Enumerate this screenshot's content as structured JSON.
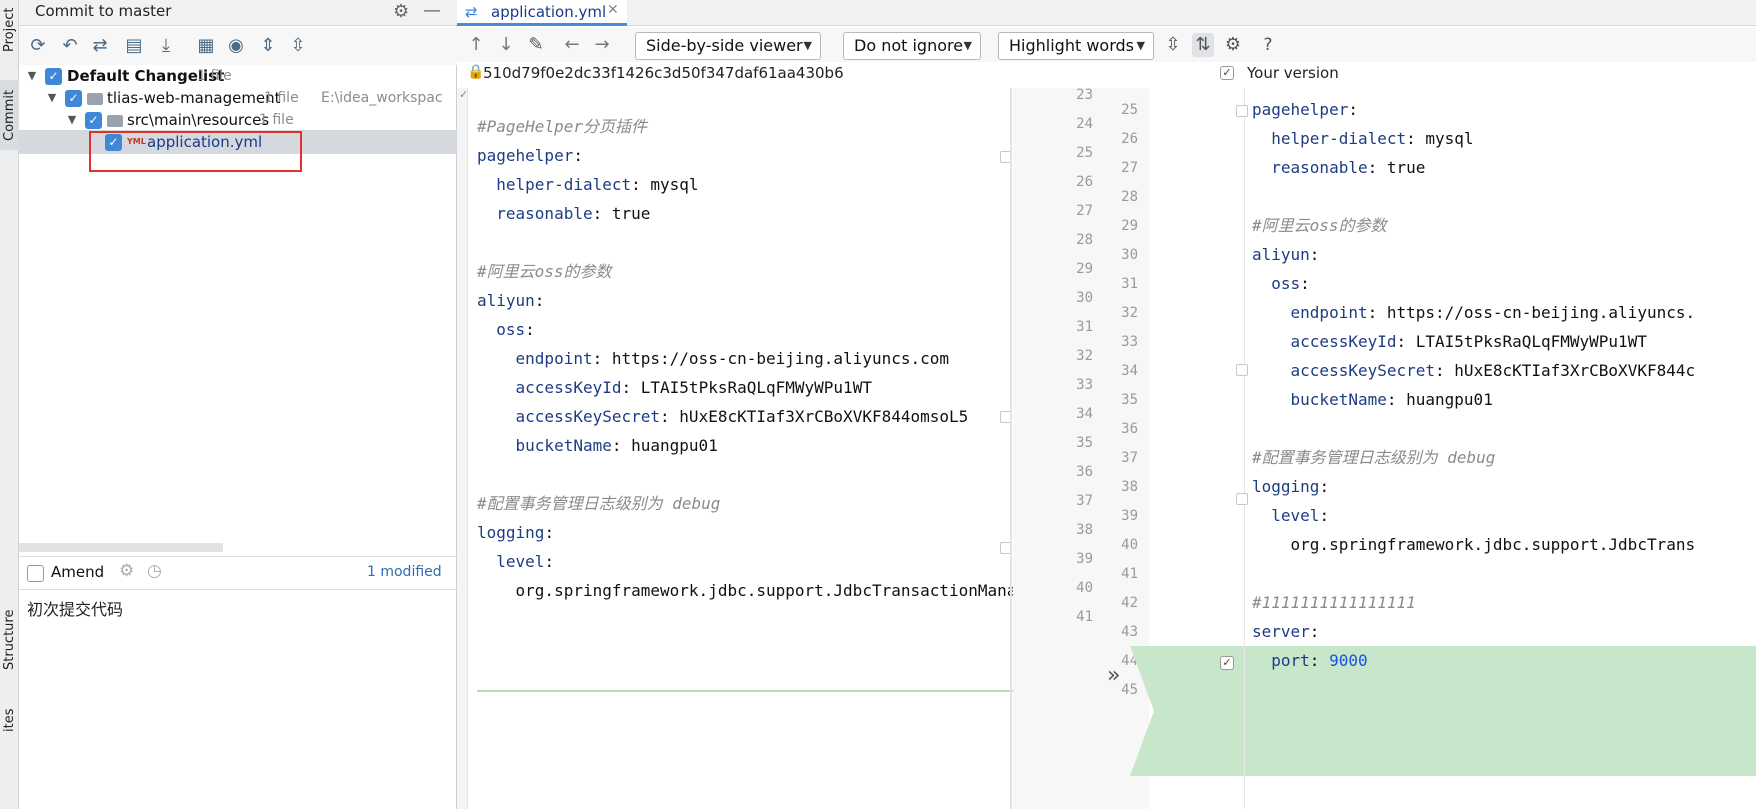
{
  "side_stripe": {
    "project": "Project",
    "commit": "Commit",
    "structure": "Structure",
    "favorites": "ites"
  },
  "left_panel": {
    "title": "Commit to master",
    "tree": {
      "changelist": {
        "label": "Default Changelist",
        "count": "1 file"
      },
      "module": {
        "label": "tlias-web-management",
        "count": "1 file",
        "path": "E:\\idea_workspac"
      },
      "folder": {
        "label": "src\\main\\resources",
        "count": "1 file"
      },
      "file": {
        "label": "application.yml",
        "icon_text": "YML"
      }
    },
    "amend_label": "Amend",
    "modified_label": "1 modified",
    "commit_message": "初次提交代码"
  },
  "diff": {
    "tab_label": "application.yml",
    "viewer_select": "Side-by-side viewer",
    "ignore_select": "Do not ignore",
    "highlight_select": "Highlight words",
    "help": "?",
    "revision_hash": "510d79f0e2dc33f1426c3d50f347daf61aa430b6",
    "your_version_label": "Your version",
    "colors": {
      "added_bg": "#c8e6c9",
      "key": "#1d3c82",
      "comment": "#8b8b8b",
      "number": "#1750eb"
    },
    "left_lines": [
      {
        "indent": "",
        "comment": "#PageHelper分页插件"
      },
      {
        "indent": "",
        "key": "pagehelper",
        "sep": ":"
      },
      {
        "indent": "  ",
        "key": "helper-dialect",
        "sep": ": ",
        "value": "mysql"
      },
      {
        "indent": "  ",
        "key": "reasonable",
        "sep": ": ",
        "value": "true"
      },
      {
        "indent": ""
      },
      {
        "indent": "",
        "comment": "#阿里云oss的参数"
      },
      {
        "indent": "",
        "key": "aliyun",
        "sep": ":"
      },
      {
        "indent": "  ",
        "key": "oss",
        "sep": ":"
      },
      {
        "indent": "    ",
        "key": "endpoint",
        "sep": ": ",
        "value": "https://oss-cn-beijing.aliyuncs.com"
      },
      {
        "indent": "    ",
        "key": "accessKeyId",
        "sep": ": ",
        "value": "LTAI5tPksRaQLqFMWyWPu1WT"
      },
      {
        "indent": "    ",
        "key": "accessKeySecret",
        "sep": ": ",
        "value": "hUxE8cKTIaf3XrCBoXVKF844omsoL5"
      },
      {
        "indent": "    ",
        "key": "bucketName",
        "sep": ": ",
        "value": "huangpu01"
      },
      {
        "indent": ""
      },
      {
        "indent": "",
        "comment": "#配置事务管理日志级别为 debug"
      },
      {
        "indent": "",
        "key": "logging",
        "sep": ":"
      },
      {
        "indent": "  ",
        "key": "level",
        "sep": ":"
      },
      {
        "indent": "    ",
        "value": "org.springframework.jdbc.support.JdbcTransactionMana"
      }
    ],
    "mid_left_numbers": [
      "23",
      "24",
      "25",
      "26",
      "27",
      "28",
      "29",
      "30",
      "31",
      "32",
      "33",
      "34",
      "35",
      "36",
      "37",
      "38",
      "39",
      "40",
      "41"
    ],
    "right_numbers": [
      "25",
      "26",
      "27",
      "28",
      "29",
      "30",
      "31",
      "32",
      "33",
      "34",
      "35",
      "36",
      "37",
      "38",
      "39",
      "40",
      "41",
      "42",
      "43",
      "44",
      "45"
    ],
    "right_lines": [
      {
        "indent": "",
        "key": "pagehelper",
        "sep": ":"
      },
      {
        "indent": "  ",
        "key": "helper-dialect",
        "sep": ": ",
        "value": "mysql"
      },
      {
        "indent": "  ",
        "key": "reasonable",
        "sep": ": ",
        "value": "true"
      },
      {
        "indent": ""
      },
      {
        "indent": "",
        "comment": "#阿里云oss的参数"
      },
      {
        "indent": "",
        "key": "aliyun",
        "sep": ":"
      },
      {
        "indent": "  ",
        "key": "oss",
        "sep": ":"
      },
      {
        "indent": "    ",
        "key": "endpoint",
        "sep": ": ",
        "value": "https://oss-cn-beijing.aliyuncs."
      },
      {
        "indent": "    ",
        "key": "accessKeyId",
        "sep": ": ",
        "value": "LTAI5tPksRaQLqFMWyWPu1WT"
      },
      {
        "indent": "    ",
        "key": "accessKeySecret",
        "sep": ": ",
        "value": "hUxE8cKTIaf3XrCBoXVKF844c"
      },
      {
        "indent": "    ",
        "key": "bucketName",
        "sep": ": ",
        "value": "huangpu01"
      },
      {
        "indent": ""
      },
      {
        "indent": "",
        "comment": "#配置事务管理日志级别为 debug"
      },
      {
        "indent": "",
        "key": "logging",
        "sep": ":"
      },
      {
        "indent": "  ",
        "key": "level",
        "sep": ":"
      },
      {
        "indent": "    ",
        "value": "org.springframework.jdbc.support.JdbcTrans"
      },
      {
        "indent": ""
      },
      {
        "indent": "",
        "comment": "#1111111111111111"
      },
      {
        "indent": "",
        "key": "server",
        "sep": ":"
      },
      {
        "indent": "  ",
        "key": "port",
        "sep": ": ",
        "number": "9000"
      },
      {
        "indent": ""
      }
    ]
  }
}
